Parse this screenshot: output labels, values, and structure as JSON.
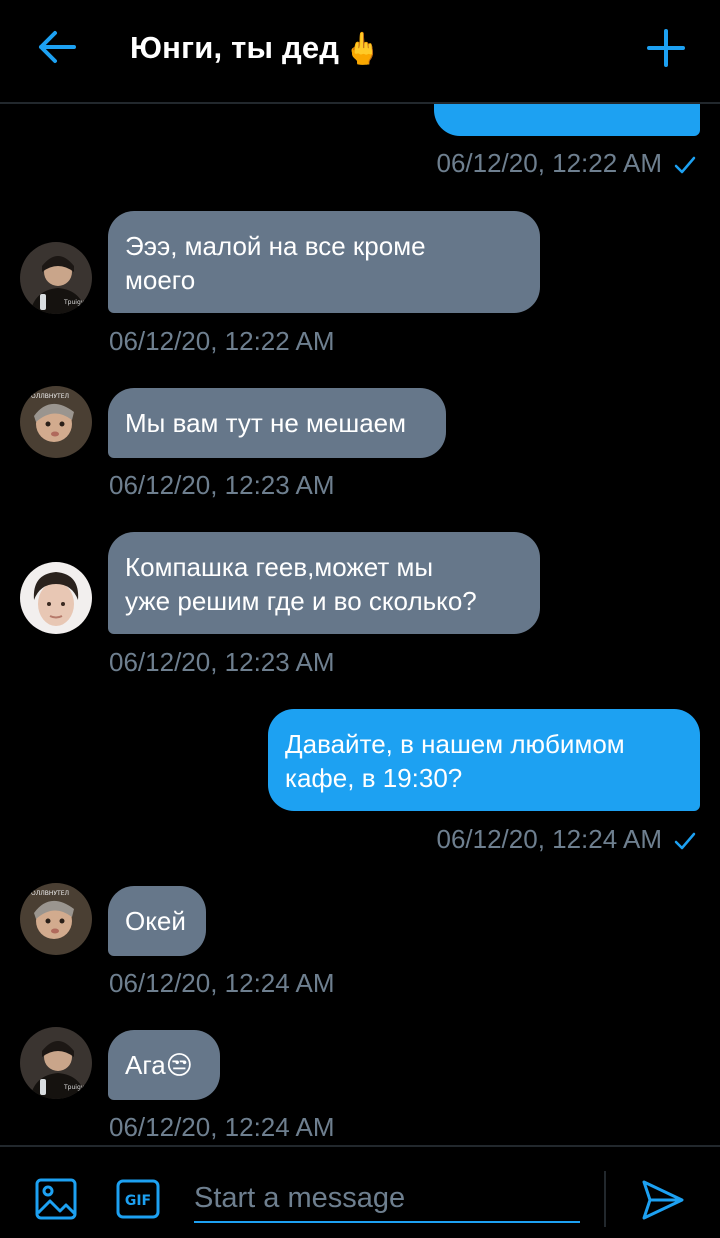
{
  "header": {
    "title": "Юнги, ты дед",
    "title_emoji": "🖕"
  },
  "colors": {
    "accent": "#1da1f2",
    "incoming_bubble": "#66778a",
    "timestamp": "#6e7f8f",
    "background": "#000000"
  },
  "messages": [
    {
      "direction": "out",
      "text": "",
      "timestamp": "06/12/20, 12:22 AM",
      "read": true
    },
    {
      "direction": "in",
      "avatar": "avatar-yoongi",
      "text": "Эээ, малой на все кроме\nмоего",
      "timestamp": "06/12/20, 12:22 AM"
    },
    {
      "direction": "in",
      "avatar": "avatar-namjoon",
      "text": "Мы вам тут не мешаем",
      "timestamp": "06/12/20, 12:23 AM"
    },
    {
      "direction": "in",
      "avatar": "avatar-hoseok",
      "text": "Компашка геев,может мы\nуже решим где и во сколько?",
      "timestamp": "06/12/20, 12:23 AM"
    },
    {
      "direction": "out",
      "text": "Давайте, в нашем любимом\nкафе, в 19:30?",
      "timestamp": "06/12/20, 12:24 AM",
      "read": true
    },
    {
      "direction": "in",
      "avatar": "avatar-namjoon",
      "text": "Окей",
      "timestamp": "06/12/20, 12:24 AM"
    },
    {
      "direction": "in",
      "avatar": "avatar-yoongi",
      "text": "Ага",
      "emoji": "😒",
      "timestamp": "06/12/20, 12:24 AM"
    }
  ],
  "composer": {
    "placeholder": "Start a message",
    "gif_label": "GIF"
  },
  "icons": {
    "back": "arrow-left-icon",
    "add": "plus-icon",
    "media": "image-icon",
    "gif": "gif-icon",
    "send": "send-icon",
    "read": "checkmark-icon"
  }
}
